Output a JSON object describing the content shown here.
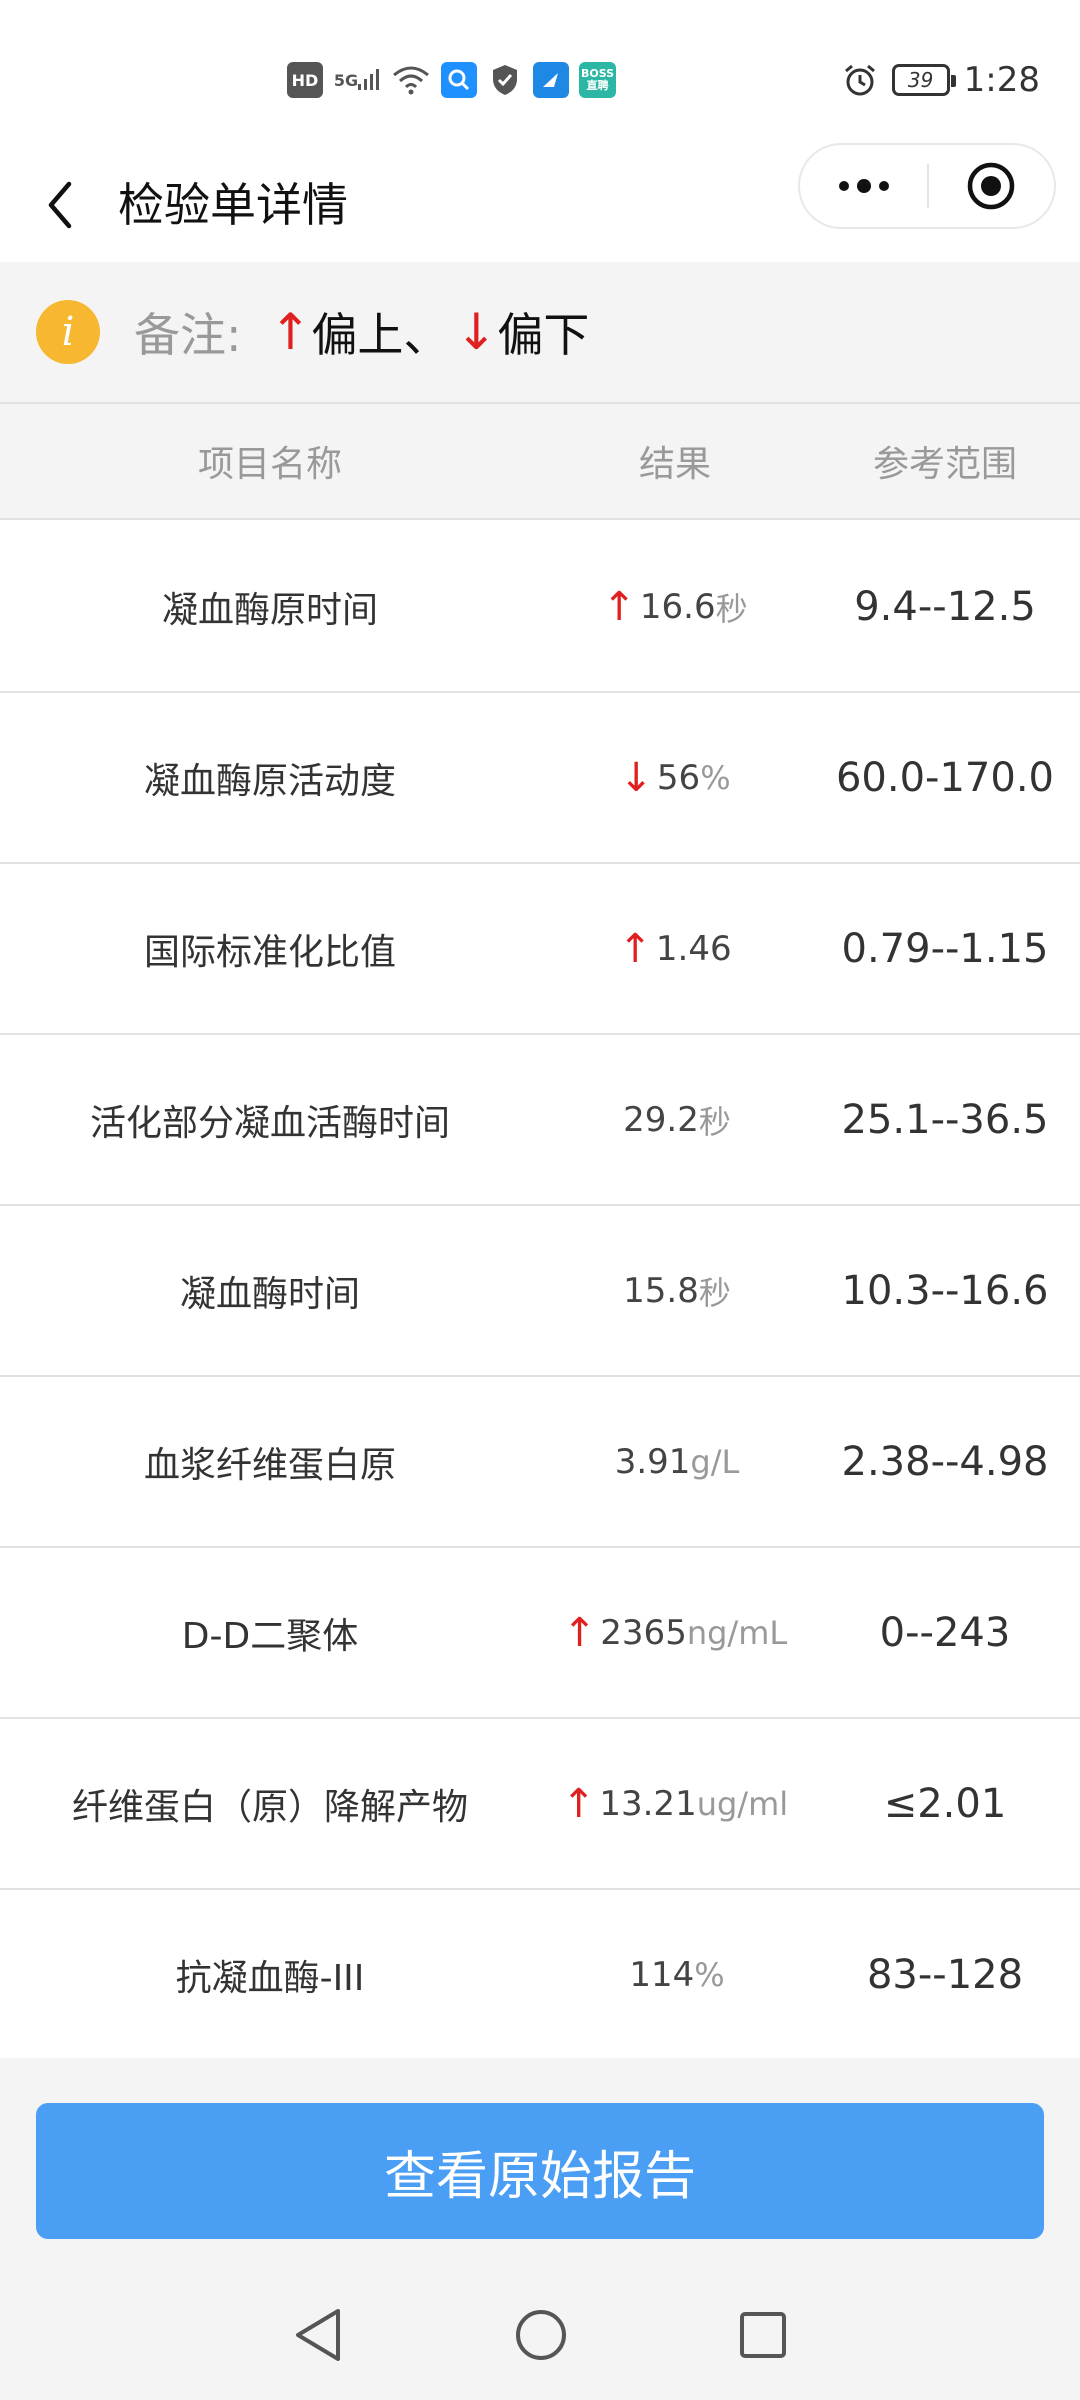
{
  "status_bar": {
    "time": "1:28",
    "battery_level": "39",
    "network_label": "5G",
    "hd_label": "HD",
    "boss_label": "BOSS\n直聘",
    "icons": [
      "hd-icon",
      "signal-5g-icon",
      "wifi-icon",
      "search-app-icon",
      "shield-icon",
      "app-icon",
      "boss-app-icon",
      "alarm-icon",
      "battery-icon"
    ]
  },
  "header": {
    "title": "检验单详情",
    "back_icon": "chevron-left-icon",
    "more_icon": "more-dots-icon",
    "close_icon": "target-circle-icon"
  },
  "note": {
    "label": "备注:",
    "up_arrow": "↑",
    "up_text": "偏上、",
    "down_arrow": "↓",
    "down_text": "偏下",
    "icon": "info-icon",
    "icon_color": "#f7b731"
  },
  "table": {
    "columns": [
      "项目名称",
      "结果",
      "参考范围"
    ],
    "rows": [
      {
        "name": "凝血酶原时间",
        "flag": "↑",
        "value": "16.6",
        "unit": "秒",
        "range": "9.4--12.5"
      },
      {
        "name": "凝血酶原活动度",
        "flag": "↓",
        "value": "56",
        "unit": "%",
        "range": "60.0-170.0"
      },
      {
        "name": "国际标准化比值",
        "flag": "↑",
        "value": "1.46",
        "unit": "",
        "range": "0.79--1.15"
      },
      {
        "name": "活化部分凝血活酶时间",
        "flag": "",
        "value": "29.2",
        "unit": "秒",
        "range": "25.1--36.5"
      },
      {
        "name": "凝血酶时间",
        "flag": "",
        "value": "15.8",
        "unit": "秒",
        "range": "10.3--16.6"
      },
      {
        "name": "血浆纤维蛋白原",
        "flag": "",
        "value": "3.91",
        "unit": "g/L",
        "range": "2.38--4.98"
      },
      {
        "name": "D-D二聚体",
        "flag": "↑",
        "value": "2365",
        "unit": "ng/mL",
        "range": "0--243"
      },
      {
        "name": "纤维蛋白（原）降解产物",
        "flag": "↑",
        "value": "13.21",
        "unit": "ug/ml",
        "range": "≤2.01"
      },
      {
        "name": "抗凝血酶-III",
        "flag": "",
        "value": "114",
        "unit": "%",
        "range": "83--128"
      }
    ]
  },
  "footer": {
    "button_label": "查看原始报告",
    "button_color": "#4a9ef3"
  },
  "nav": {
    "icons": [
      "back-triangle-icon",
      "home-circle-icon",
      "recents-square-icon"
    ]
  },
  "colors": {
    "flag": "#e02020",
    "unit": "#999999",
    "background": "#f4f4f4"
  }
}
